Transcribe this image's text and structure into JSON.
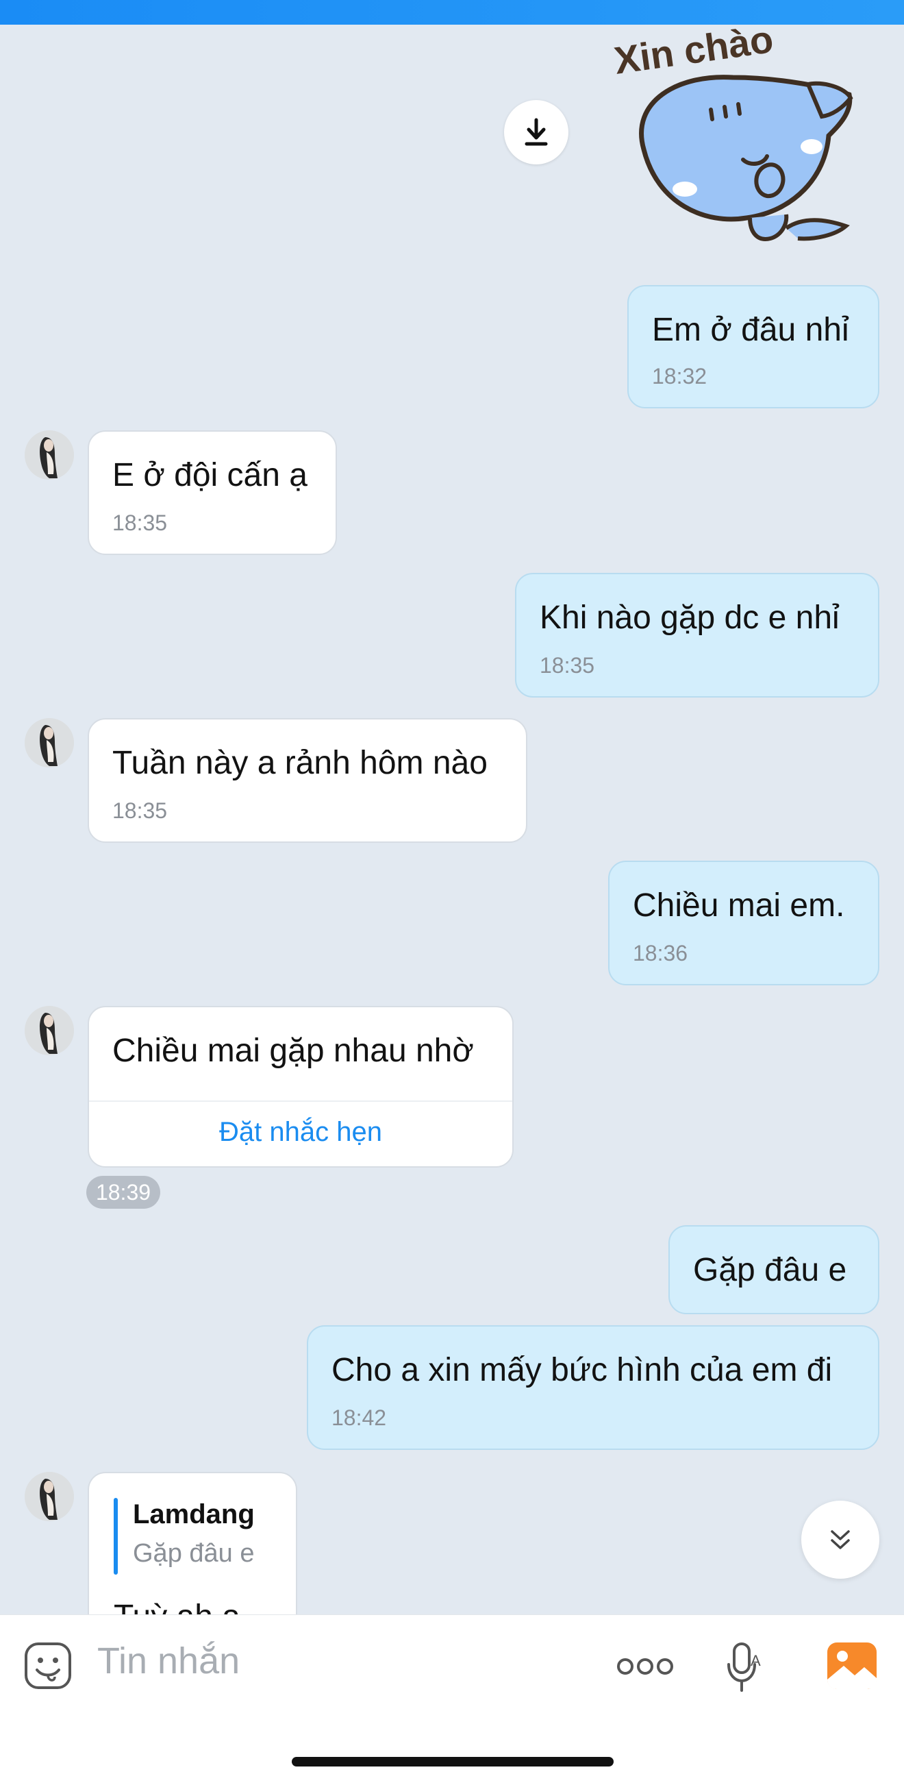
{
  "sticker": {
    "text": "Xin chào"
  },
  "messages": [
    {
      "dir": "out",
      "text": "Em ở đâu nhỉ",
      "time": "18:32"
    },
    {
      "dir": "in",
      "text": "E ở đội cấn ạ",
      "time": "18:35"
    },
    {
      "dir": "out",
      "text": "Khi nào gặp dc e nhỉ",
      "time": "18:35"
    },
    {
      "dir": "in",
      "text": "Tuần này a rảnh hôm nào",
      "time": "18:35"
    },
    {
      "dir": "out",
      "text": "Chiều mai em.",
      "time": "18:36"
    },
    {
      "dir": "in",
      "text": "Chiều mai gặp nhau nhờ",
      "action": "Đặt nhắc hẹn",
      "time": "18:39"
    },
    {
      "dir": "out",
      "text": "Gặp đâu e"
    },
    {
      "dir": "out",
      "text": "Cho a xin mấy bức hình của em đi",
      "time": "18:42"
    },
    {
      "dir": "in",
      "quote_name": "Lamdang",
      "quote_text": "Gặp đâu e",
      "text": "Tuỳ ah a"
    }
  ],
  "composer": {
    "placeholder": "Tin nhắn"
  },
  "icons": [
    "download-icon",
    "sticker-icon",
    "more-icon",
    "voice-icon",
    "image-icon",
    "scroll-down-icon"
  ],
  "colors": {
    "accent": "#1a8cf0",
    "outgoing_bubble": "#d3eefc",
    "background": "#e2e9f1"
  }
}
